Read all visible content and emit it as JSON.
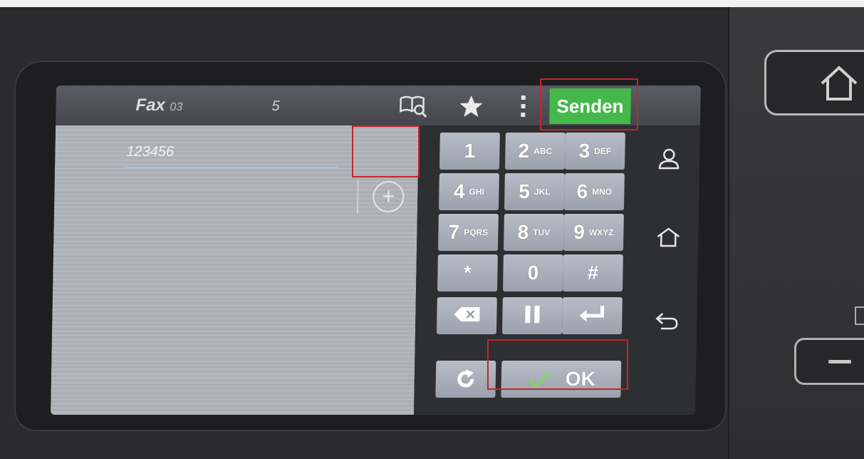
{
  "titlebar": {
    "title": "Fax",
    "number_prefix": "03",
    "number_suffix": "5",
    "address_book_icon": "address-book-search-icon",
    "favorite_icon": "star-icon",
    "menu_icon": "kebab-menu-icon",
    "send_label": "Senden"
  },
  "entry": {
    "value": "123456",
    "add_icon": "plus-circle-icon"
  },
  "keypad": {
    "keys": [
      {
        "digit": "1",
        "letters": ""
      },
      {
        "digit": "2",
        "letters": "ABC"
      },
      {
        "digit": "3",
        "letters": "DEF"
      },
      {
        "digit": "4",
        "letters": "GHI"
      },
      {
        "digit": "5",
        "letters": "JKL"
      },
      {
        "digit": "6",
        "letters": "MNO"
      },
      {
        "digit": "7",
        "letters": "PQRS"
      },
      {
        "digit": "8",
        "letters": "TUV"
      },
      {
        "digit": "9",
        "letters": "WXYZ"
      },
      {
        "digit": "*",
        "letters": ""
      },
      {
        "digit": "0",
        "letters": ""
      },
      {
        "digit": "#",
        "letters": ""
      }
    ],
    "backspace_icon": "backspace-icon",
    "pause_icon": "pause-icon",
    "enter_icon": "enter-icon",
    "redial_icon": "redial-icon",
    "ok_label": "OK",
    "ok_icon": "checkmark-icon"
  },
  "sidebar": {
    "icons": [
      "user-icon",
      "home-icon",
      "back-icon"
    ]
  },
  "colors": {
    "send_green": "#44b84a",
    "highlight_red": "#c8232b",
    "ok_check_green": "#7ed957"
  }
}
